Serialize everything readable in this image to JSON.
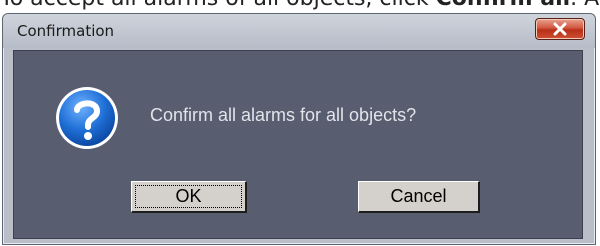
{
  "page_text": {
    "prefix": "To accept all alarms of all objects, click ",
    "bold": "Confirm all",
    "suffix": ". A"
  },
  "dialog": {
    "title": "Confirmation",
    "message": "Confirm all alarms for all objects?",
    "ok_label": "OK",
    "cancel_label": "Cancel",
    "icon": "question-icon",
    "close_icon": "close-icon"
  },
  "colors": {
    "client_background": "#585d6f",
    "frame": "#b9bec9",
    "close_button": "#c94a30",
    "icon_blue": "#1f6fd6",
    "button_face": "#d4d0cb"
  }
}
